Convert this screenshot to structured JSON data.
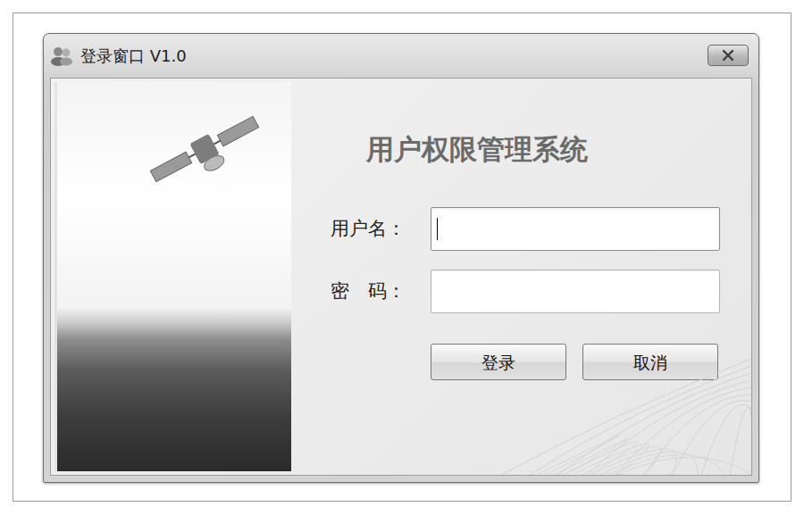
{
  "window": {
    "title": "登录窗口 V1.0"
  },
  "heading": "用户权限管理系统",
  "fields": [
    {
      "label": "用户名：",
      "value": "",
      "kind": "text",
      "focused": true
    },
    {
      "label": "密　码：",
      "value": "",
      "kind": "password",
      "focused": false
    }
  ],
  "buttons": [
    "登录",
    "取消"
  ]
}
